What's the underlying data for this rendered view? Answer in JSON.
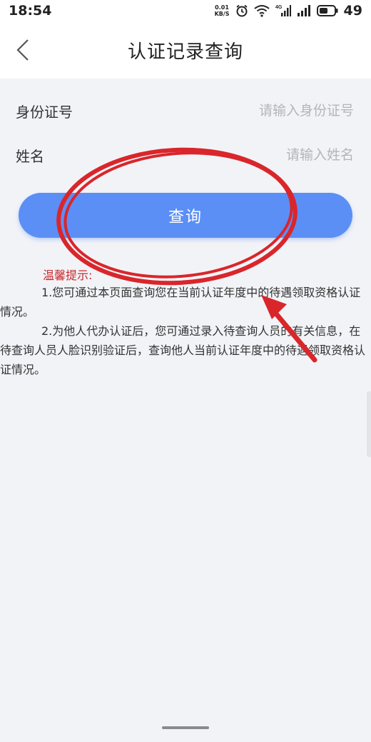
{
  "status_bar": {
    "time": "18:54",
    "net_speed_value": "0.01",
    "net_speed_unit": "KB/S",
    "network_type": "4G",
    "battery": "49"
  },
  "nav": {
    "title": "认证记录查询",
    "back_icon": "chevron-left-icon"
  },
  "form": {
    "id_label": "身份证号",
    "id_placeholder": "请输入身份证号",
    "name_label": "姓名",
    "name_placeholder": "请输入姓名"
  },
  "query_button": {
    "label": "查询"
  },
  "tips": {
    "title": "温馨提示:",
    "item1": "1.您可通过本页面查询您在当前认证年度中的待遇领取资格认证情况。",
    "item2": "2.为他人代办认证后，您可通过录入待查询人员的有关信息，在待查询人员人脸识别验证后，查询他人当前认证年度中的待遇领取资格认证情况。"
  },
  "colors": {
    "accent": "#5b8ff6",
    "tip_title": "#c8282b",
    "annotation": "#d9262b",
    "background": "#f2f3f7"
  }
}
